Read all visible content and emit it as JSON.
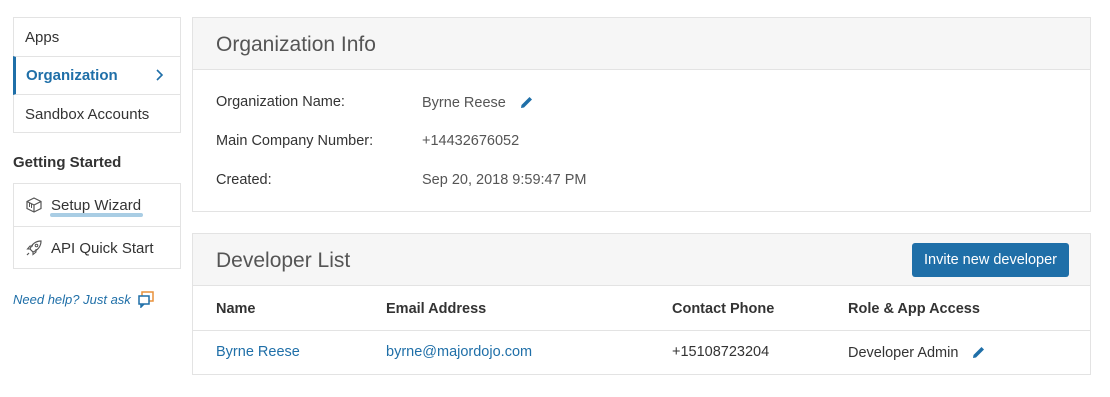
{
  "sidebar": {
    "items": [
      {
        "label": "Apps"
      },
      {
        "label": "Organization"
      },
      {
        "label": "Sandbox Accounts"
      }
    ],
    "getting_started": {
      "heading": "Getting Started",
      "items": [
        {
          "label": "Setup Wizard",
          "icon": "cube-icon"
        },
        {
          "label": "API Quick Start",
          "icon": "rocket-icon"
        }
      ]
    },
    "help_text": "Need help? Just ask"
  },
  "org_info": {
    "title": "Organization Info",
    "rows": [
      {
        "label": "Organization Name:",
        "value": "Byrne Reese"
      },
      {
        "label": "Main Company Number:",
        "value": "+14432676052"
      },
      {
        "label": "Created:",
        "value": "Sep 20, 2018 9:59:47 PM"
      }
    ]
  },
  "developer_list": {
    "title": "Developer List",
    "invite_label": "Invite new developer",
    "columns": [
      "Name",
      "Email Address",
      "Contact Phone",
      "Role & App Access"
    ],
    "rows": [
      {
        "name": "Byrne Reese",
        "email": "byrne@majordojo.com",
        "phone": "+15108723204",
        "role": "Developer Admin"
      }
    ]
  },
  "colors": {
    "accent": "#1f6fa8",
    "panel_header_bg": "#f6f6f6",
    "border": "#e3e3e3"
  }
}
